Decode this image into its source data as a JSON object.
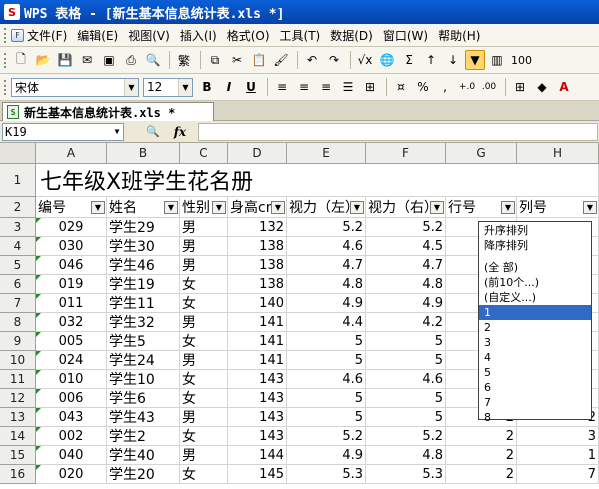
{
  "window": {
    "title": "WPS 表格 - [新生基本信息统计表.xls *]",
    "app_icon_glyph": "S"
  },
  "menu": [
    "文件(F)",
    "编辑(E)",
    "视图(V)",
    "插入(I)",
    "格式(O)",
    "工具(T)",
    "数据(D)",
    "窗口(W)",
    "帮助(H)"
  ],
  "toolbar": {
    "zoom_text": "100"
  },
  "format_toolbar": {
    "font_name": "宋体",
    "font_size": "12",
    "bold_label": "B",
    "italic_label": "I",
    "underline_label": "U",
    "percent_label": "%",
    "inc_decimal": "+.0",
    "dec_decimal": ".00"
  },
  "doc_tab": {
    "label": "新生基本信息统计表.xls *"
  },
  "formula_bar": {
    "name_box": "K19",
    "fx_label": "fx"
  },
  "grid": {
    "columns": [
      "A",
      "B",
      "C",
      "D",
      "E",
      "F",
      "G",
      "H"
    ],
    "title": "七年级X班学生花名册",
    "headers": [
      "编号",
      "姓名",
      "性别",
      "身高cm",
      "视力（左）",
      "视力（右）",
      "行号",
      "列号"
    ],
    "rows": [
      {
        "n": "3",
        "id": "029",
        "name": "学生29",
        "sex": "男",
        "h": "132",
        "l": "5.2",
        "r": "5.2",
        "g": "",
        "c": ""
      },
      {
        "n": "4",
        "id": "030",
        "name": "学生30",
        "sex": "男",
        "h": "138",
        "l": "4.6",
        "r": "4.5",
        "g": "",
        "c": ""
      },
      {
        "n": "5",
        "id": "046",
        "name": "学生46",
        "sex": "男",
        "h": "138",
        "l": "4.7",
        "r": "4.7",
        "g": "",
        "c": ""
      },
      {
        "n": "6",
        "id": "019",
        "name": "学生19",
        "sex": "女",
        "h": "138",
        "l": "4.8",
        "r": "4.8",
        "g": "",
        "c": ""
      },
      {
        "n": "7",
        "id": "011",
        "name": "学生11",
        "sex": "女",
        "h": "140",
        "l": "4.9",
        "r": "4.9",
        "g": "",
        "c": ""
      },
      {
        "n": "8",
        "id": "032",
        "name": "学生32",
        "sex": "男",
        "h": "141",
        "l": "4.4",
        "r": "4.2",
        "g": "",
        "c": ""
      },
      {
        "n": "9",
        "id": "005",
        "name": "学生5",
        "sex": "女",
        "h": "141",
        "l": "5",
        "r": "5",
        "g": "",
        "c": ""
      },
      {
        "n": "10",
        "id": "024",
        "name": "学生24",
        "sex": "男",
        "h": "141",
        "l": "5",
        "r": "5",
        "g": "",
        "c": ""
      },
      {
        "n": "11",
        "id": "010",
        "name": "学生10",
        "sex": "女",
        "h": "143",
        "l": "4.6",
        "r": "4.6",
        "g": "",
        "c": ""
      },
      {
        "n": "12",
        "id": "006",
        "name": "学生6",
        "sex": "女",
        "h": "143",
        "l": "5",
        "r": "5",
        "g": "",
        "c": ""
      },
      {
        "n": "13",
        "id": "043",
        "name": "学生43",
        "sex": "男",
        "h": "143",
        "l": "5",
        "r": "5",
        "g": "2",
        "c": "2"
      },
      {
        "n": "14",
        "id": "002",
        "name": "学生2",
        "sex": "女",
        "h": "143",
        "l": "5.2",
        "r": "5.2",
        "g": "2",
        "c": "3"
      },
      {
        "n": "15",
        "id": "040",
        "name": "学生40",
        "sex": "男",
        "h": "144",
        "l": "4.9",
        "r": "4.8",
        "g": "2",
        "c": "1"
      },
      {
        "n": "16",
        "id": "020",
        "name": "学生20",
        "sex": "女",
        "h": "145",
        "l": "5.3",
        "r": "5.3",
        "g": "2",
        "c": "7"
      }
    ]
  },
  "filter_dropdown": {
    "sort_items": [
      "升序排列",
      "降序排列"
    ],
    "filter_items": [
      "(全  部)",
      "(前10个...)",
      "(自定义...)"
    ],
    "values": [
      "1",
      "2",
      "3",
      "4",
      "5",
      "6",
      "7",
      "8"
    ],
    "selected": "1"
  }
}
